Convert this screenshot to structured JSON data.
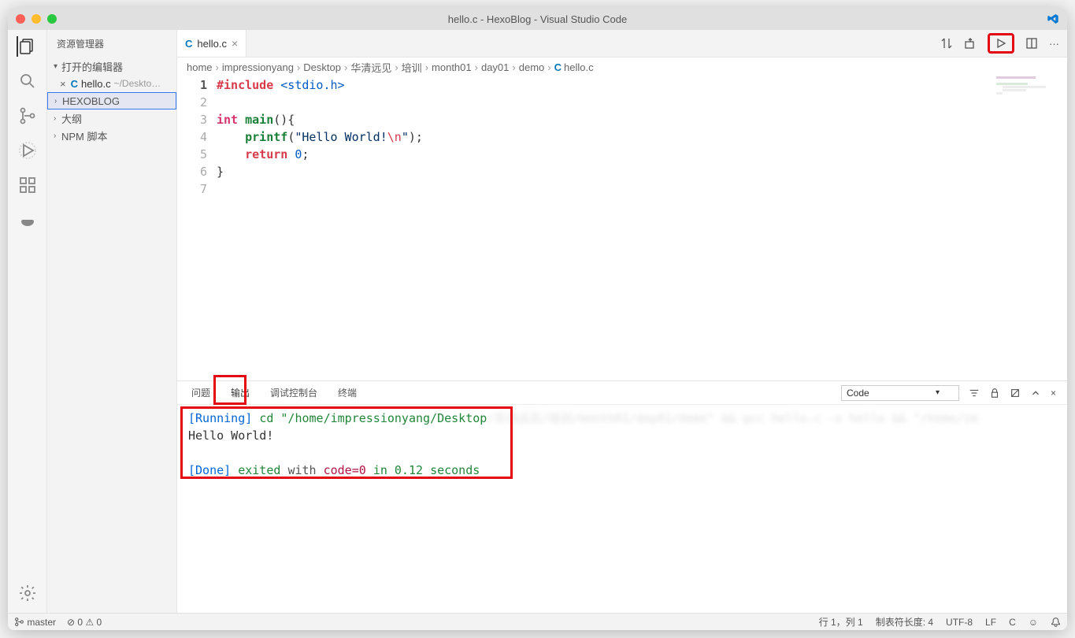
{
  "window": {
    "title": "hello.c - HexoBlog - Visual Studio Code"
  },
  "sidebar": {
    "header": "资源管理器",
    "open_editors": "打开的编辑器",
    "open_file": {
      "name": "hello.c",
      "path": "~/Deskto…"
    },
    "project": "HEXOBLOG",
    "outline": "大纲",
    "npm": "NPM 脚本"
  },
  "tab": {
    "filename": "hello.c"
  },
  "breadcrumb": [
    "home",
    "impressionyang",
    "Desktop",
    "华清远见",
    "培训",
    "month01",
    "day01",
    "demo",
    "hello.c"
  ],
  "code": {
    "lines": [
      "1",
      "2",
      "3",
      "4",
      "5",
      "6",
      "7"
    ],
    "include": "#include",
    "header": "<stdio.h>",
    "int": "int",
    "main": "main",
    "parenbrace": "(){",
    "printf": "printf",
    "string": "\"Hello World!",
    "esc": "\\n",
    "strend": "\"",
    "semi": ";",
    "after_printf": ");",
    "return": "return",
    "zero": "0",
    "cb": "}"
  },
  "panel": {
    "tabs": {
      "problems": "问题",
      "output": "输出",
      "debug": "调试控制台",
      "terminal": "终端"
    },
    "select": "Code",
    "running_label": "[Running]",
    "running_cmd": "cd \"/home/impressionyang/Desktop",
    "hello_out": "Hello World!",
    "done_label": "[Done]",
    "exited": "exited",
    "with": "with",
    "codeeq": "code=0",
    "in": "in",
    "time": "0.12",
    "seconds": "seconds"
  },
  "status": {
    "branch": "master",
    "errors": "0",
    "warnings": "0",
    "lncol": "行 1，列 1",
    "tab": "制表符长度: 4",
    "encoding": "UTF-8",
    "eol": "LF",
    "lang": "C"
  }
}
